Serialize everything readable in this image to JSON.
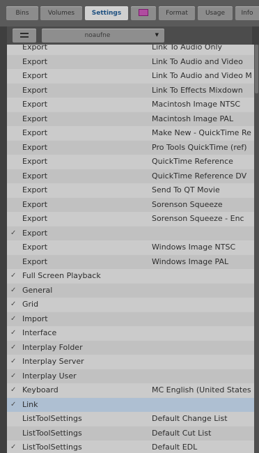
{
  "tabs": [
    {
      "label": "Bins",
      "active": false
    },
    {
      "label": "Volumes",
      "active": false
    },
    {
      "label": "Settings",
      "active": true
    },
    {
      "icon": "command-palette-icon",
      "active": false
    },
    {
      "label": "Format",
      "active": false
    },
    {
      "label": "Usage",
      "active": false
    },
    {
      "label": "Info",
      "active": false
    }
  ],
  "toolbar": {
    "menu_icon": "fast-menu-icon",
    "dropdown_value": "noaufne"
  },
  "settings": [
    {
      "checked": false,
      "name": "Export",
      "value": "Link To Audio Only"
    },
    {
      "checked": false,
      "name": "Export",
      "value": "Link To Audio and Video"
    },
    {
      "checked": false,
      "name": "Export",
      "value": "Link To Audio and Video M"
    },
    {
      "checked": false,
      "name": "Export",
      "value": "Link To Effects Mixdown"
    },
    {
      "checked": false,
      "name": "Export",
      "value": "Macintosh Image NTSC"
    },
    {
      "checked": false,
      "name": "Export",
      "value": "Macintosh Image PAL"
    },
    {
      "checked": false,
      "name": "Export",
      "value": "Make New - QuickTime Re"
    },
    {
      "checked": false,
      "name": "Export",
      "value": "Pro Tools QuickTime (ref)"
    },
    {
      "checked": false,
      "name": "Export",
      "value": "QuickTime Reference"
    },
    {
      "checked": false,
      "name": "Export",
      "value": "QuickTime Reference DV"
    },
    {
      "checked": false,
      "name": "Export",
      "value": "Send To QT Movie"
    },
    {
      "checked": false,
      "name": "Export",
      "value": "Sorenson Squeeze"
    },
    {
      "checked": false,
      "name": "Export",
      "value": "Sorenson Squeeze - Enc"
    },
    {
      "checked": true,
      "name": "Export",
      "value": ""
    },
    {
      "checked": false,
      "name": "Export",
      "value": "Windows Image NTSC"
    },
    {
      "checked": false,
      "name": "Export",
      "value": "Windows Image PAL"
    },
    {
      "checked": true,
      "name": "Full Screen Playback",
      "value": ""
    },
    {
      "checked": true,
      "name": "General",
      "value": ""
    },
    {
      "checked": true,
      "name": "Grid",
      "value": ""
    },
    {
      "checked": true,
      "name": "Import",
      "value": ""
    },
    {
      "checked": true,
      "name": "Interface",
      "value": ""
    },
    {
      "checked": true,
      "name": "Interplay Folder",
      "value": ""
    },
    {
      "checked": true,
      "name": "Interplay Server",
      "value": ""
    },
    {
      "checked": true,
      "name": "Interplay User",
      "value": ""
    },
    {
      "checked": true,
      "name": "Keyboard",
      "value": "MC English (United States"
    },
    {
      "checked": true,
      "name": "Link",
      "value": "",
      "selected": true
    },
    {
      "checked": false,
      "name": "ListToolSettings",
      "value": "Default Change List"
    },
    {
      "checked": false,
      "name": "ListToolSettings",
      "value": "Default Cut List"
    },
    {
      "checked": true,
      "name": "ListToolSettings",
      "value": "Default EDL"
    }
  ],
  "check_glyph": "✓"
}
